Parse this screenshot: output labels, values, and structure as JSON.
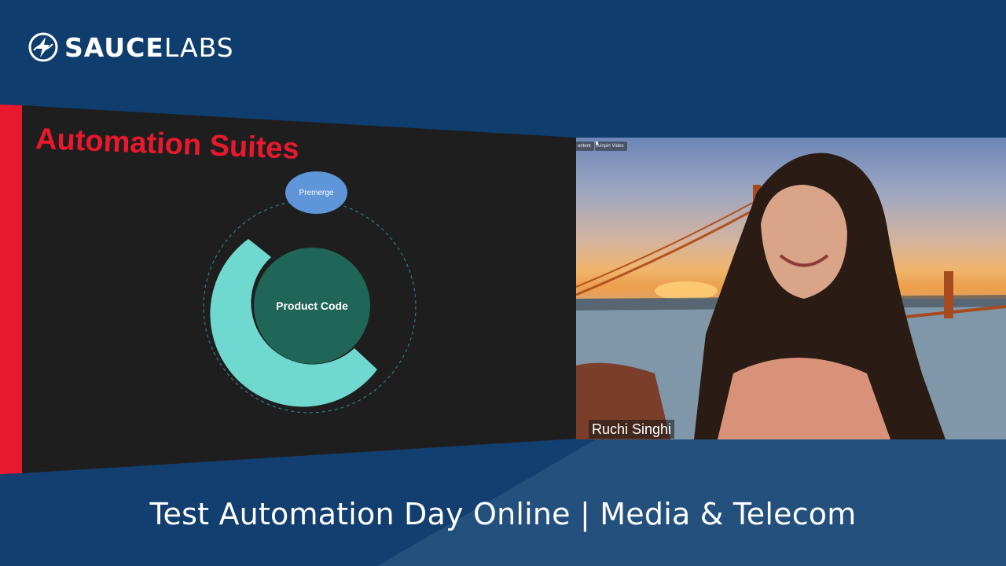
{
  "brand": {
    "logo_bold": "SAUCE",
    "logo_light": "LABS",
    "icon": "sauce-labs-bolt-icon"
  },
  "slide": {
    "title": "Automation Suites",
    "premerge_label": "Premerge",
    "center_label": "Product Code"
  },
  "video": {
    "chip_content": "ontent",
    "chip_unpin": "Unpin Video",
    "participant_name": "Ruchi Singhi"
  },
  "footer": {
    "title": "Test Automation Day Online | Media & Telecom"
  },
  "colors": {
    "background": "#0f3d6e",
    "lower_band": "#1b4f84",
    "slide_bg": "#1e1e1e",
    "accent_red": "#e8192c",
    "ring_teal": "#6fd8cf",
    "center_teal": "#1f6657",
    "premerge_blue": "#5f95d9"
  }
}
